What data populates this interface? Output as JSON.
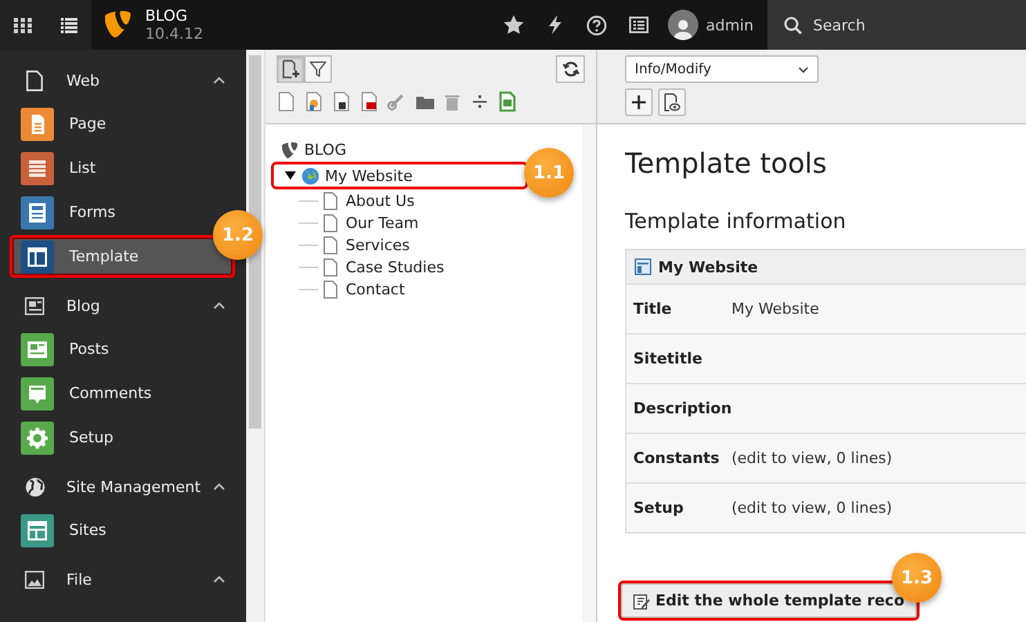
{
  "topbar": {
    "site_name": "BLOG",
    "version": "10.4.12",
    "user": "admin",
    "search": "Search"
  },
  "sidebar": {
    "groups": [
      {
        "label": "Web",
        "expanded": true,
        "items": [
          {
            "label": "Page",
            "color": "#ec8a37",
            "selected": false
          },
          {
            "label": "List",
            "color": "#c9623a",
            "selected": false
          },
          {
            "label": "Forms",
            "color": "#3a77ae",
            "selected": false
          },
          {
            "label": "Template",
            "color": "#1d4f85",
            "selected": true,
            "callout": "1.2"
          }
        ]
      },
      {
        "label": "Blog",
        "expanded": true,
        "items": [
          {
            "label": "Posts",
            "color": "#58a94c",
            "selected": false
          },
          {
            "label": "Comments",
            "color": "#58a94c",
            "selected": false
          },
          {
            "label": "Setup",
            "color": "#58a94c",
            "selected": false
          }
        ]
      },
      {
        "label": "Site Management",
        "expanded": true,
        "items": [
          {
            "label": "Sites",
            "color": "#3b9988",
            "selected": false
          }
        ]
      },
      {
        "label": "File",
        "expanded": true
      }
    ]
  },
  "page_tree": {
    "root": "BLOG",
    "nodes": [
      {
        "label": "My Website",
        "expanded": true,
        "callout": "1.1",
        "children": [
          {
            "label": "About Us"
          },
          {
            "label": "Our Team"
          },
          {
            "label": "Services"
          },
          {
            "label": "Case Studies"
          },
          {
            "label": "Contact"
          }
        ]
      }
    ]
  },
  "content": {
    "module_menu": "Info/Modify",
    "title": "Template tools",
    "subtitle": "Template information",
    "record": {
      "title": "My Website",
      "rows": [
        {
          "label": "Title",
          "value": "My Website"
        },
        {
          "label": "Sitetitle"
        },
        {
          "label": "Description"
        },
        {
          "label": "Constants",
          "value": "(edit to view, 0 lines)"
        },
        {
          "label": "Setup",
          "value": "(edit to view, 0 lines)"
        }
      ]
    },
    "edit_button": {
      "label": "Edit the whole template reco",
      "callout": "1.3"
    }
  }
}
